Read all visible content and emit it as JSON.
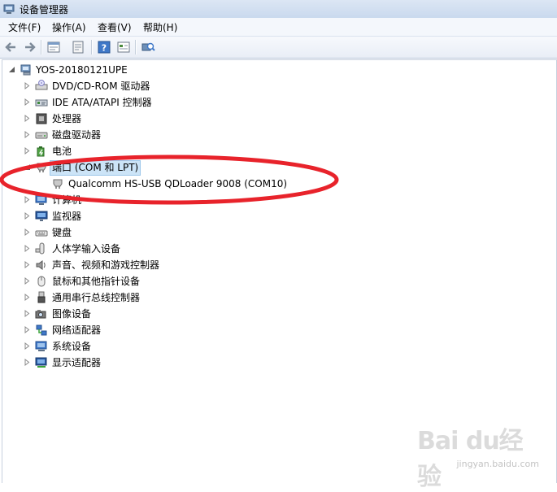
{
  "window": {
    "title": "设备管理器"
  },
  "menu": [
    {
      "label": "文件(F)"
    },
    {
      "label": "操作(A)"
    },
    {
      "label": "查看(V)"
    },
    {
      "label": "帮助(H)"
    }
  ],
  "toolbar": {
    "icons": [
      "back-arrow-icon",
      "forward-arrow-icon",
      "properties-icon",
      "update-driver-icon",
      "help-icon",
      "show-hidden-icon",
      "scan-hardware-icon"
    ]
  },
  "tree": {
    "root": {
      "label": "YOS-20180121UPE",
      "expanded": true
    },
    "categories": [
      {
        "label": "DVD/CD-ROM 驱动器",
        "icon": "dvd-drive-icon"
      },
      {
        "label": "IDE ATA/ATAPI 控制器",
        "icon": "ide-controller-icon"
      },
      {
        "label": "处理器",
        "icon": "processor-icon"
      },
      {
        "label": "磁盘驱动器",
        "icon": "disk-drive-icon"
      },
      {
        "label": "电池",
        "icon": "battery-icon"
      },
      {
        "label": "端口 (COM 和 LPT)",
        "icon": "port-icon",
        "expanded": true,
        "selected": true,
        "children": [
          {
            "label": "Qualcomm HS-USB QDLoader 9008 (COM10)",
            "icon": "port-device-icon"
          }
        ]
      },
      {
        "label": "计算机",
        "icon": "computer-icon"
      },
      {
        "label": "监视器",
        "icon": "monitor-icon"
      },
      {
        "label": "键盘",
        "icon": "keyboard-icon"
      },
      {
        "label": "人体学输入设备",
        "icon": "hid-icon"
      },
      {
        "label": "声音、视频和游戏控制器",
        "icon": "sound-icon"
      },
      {
        "label": "鼠标和其他指针设备",
        "icon": "mouse-icon"
      },
      {
        "label": "通用串行总线控制器",
        "icon": "usb-icon"
      },
      {
        "label": "图像设备",
        "icon": "camera-icon"
      },
      {
        "label": "网络适配器",
        "icon": "network-icon"
      },
      {
        "label": "系统设备",
        "icon": "system-device-icon"
      },
      {
        "label": "显示适配器",
        "icon": "display-adapter-icon"
      }
    ]
  },
  "annotation": {
    "color": "#e8232b"
  },
  "watermark": {
    "logo": "Bai du经验",
    "sub": "jingyan.baidu.com"
  }
}
